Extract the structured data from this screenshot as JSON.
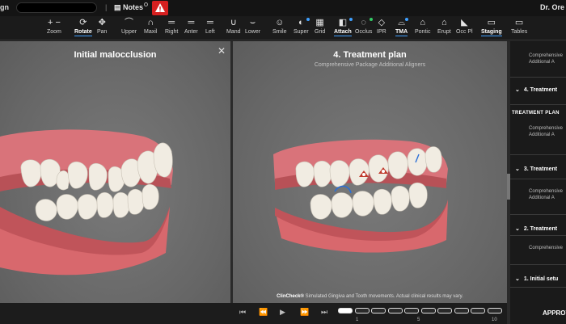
{
  "topbar": {
    "brand": "gn",
    "separator": "|",
    "notes_label": "Notes",
    "user_label": "Dr. Ore"
  },
  "toolbar": {
    "tools": [
      {
        "label": "Zoom",
        "icon": "zoom-icon",
        "glyph": "+  −"
      },
      {
        "label": "Rotate",
        "icon": "rotate-icon",
        "glyph": "⟳",
        "active": true
      },
      {
        "label": "Pan",
        "icon": "pan-icon",
        "glyph": "✥"
      },
      {
        "label": "Upper",
        "icon": "upper-jaw-icon",
        "glyph": "⌒"
      },
      {
        "label": "Maxil",
        "icon": "maxillary-icon",
        "glyph": "∩"
      },
      {
        "label": "Right",
        "icon": "right-view-icon",
        "glyph": "═"
      },
      {
        "label": "Anter",
        "icon": "anterior-view-icon",
        "glyph": "═"
      },
      {
        "label": "Left",
        "icon": "left-view-icon",
        "glyph": "═"
      },
      {
        "label": "Mand",
        "icon": "mandibular-icon",
        "glyph": "∪"
      },
      {
        "label": "Lower",
        "icon": "lower-jaw-icon",
        "glyph": "⌣"
      },
      {
        "label": "Smile",
        "icon": "smile-icon",
        "glyph": "☺"
      },
      {
        "label": "Super",
        "icon": "superimpose-icon",
        "glyph": "◐"
      },
      {
        "label": "Grid",
        "icon": "grid-icon",
        "glyph": "▦"
      },
      {
        "label": "Attach",
        "icon": "attachment-icon",
        "glyph": "◧",
        "active": true
      },
      {
        "label": "Occlus",
        "icon": "occlusion-icon",
        "glyph": "◌"
      },
      {
        "label": "IPR",
        "icon": "ipr-icon",
        "glyph": "◇"
      },
      {
        "label": "TMA",
        "icon": "tma-icon",
        "glyph": "⌓",
        "active": true
      },
      {
        "label": "Pontic",
        "icon": "pontic-icon",
        "glyph": "⌂"
      },
      {
        "label": "Erupt",
        "icon": "eruption-icon",
        "glyph": "⌂"
      },
      {
        "label": "Occ Pl",
        "icon": "occlusal-plane-icon",
        "glyph": "◣"
      },
      {
        "label": "Staging",
        "icon": "staging-icon",
        "glyph": "▭",
        "active": true
      },
      {
        "label": "Tables",
        "icon": "tables-icon",
        "glyph": "▭"
      }
    ],
    "dot_colors": {
      "attach": "#3fa0ff",
      "occlus": "#33cc66",
      "tma": "#3fa0ff",
      "super": "#3fa0ff"
    }
  },
  "left_pane": {
    "title": "Initial malocclusion",
    "close_glyph": "✕"
  },
  "right_pane": {
    "title": "4. Treatment plan",
    "subtitle": "Comprehensive Package Additional Aligners",
    "disclaimer_brand": "ClinCheck®",
    "disclaimer_text": " Simulated Gingiva and Tooth movements. Actual clinical results may vary."
  },
  "playback": {
    "buttons": [
      "⏮",
      "⏪",
      "▶",
      "⏩",
      "⏭"
    ],
    "ticks": [
      "1",
      "5",
      "10"
    ]
  },
  "sidebar": {
    "entries": [
      {
        "type": "text",
        "lines": [
          "Comprehensive",
          "Additional A"
        ]
      },
      {
        "type": "header",
        "label": "4. Treatment"
      },
      {
        "type": "plan",
        "label": "TREATMENT PLAN"
      },
      {
        "type": "text",
        "lines": [
          "Comprehensive",
          "Additional A"
        ]
      },
      {
        "type": "header",
        "label": "3. Treatment"
      },
      {
        "type": "text",
        "lines": [
          "Comprehensive",
          "Additional A"
        ]
      },
      {
        "type": "header",
        "label": "2. Treatment"
      },
      {
        "type": "text",
        "lines": [
          "Comprehensive"
        ]
      },
      {
        "type": "header",
        "label": "1. Initial setu"
      }
    ],
    "approve_label": "APPROV"
  },
  "colors": {
    "alert": "#d62020",
    "accent": "#3fa0ff",
    "gum": "#e0767a",
    "tooth": "#f3efe6"
  }
}
